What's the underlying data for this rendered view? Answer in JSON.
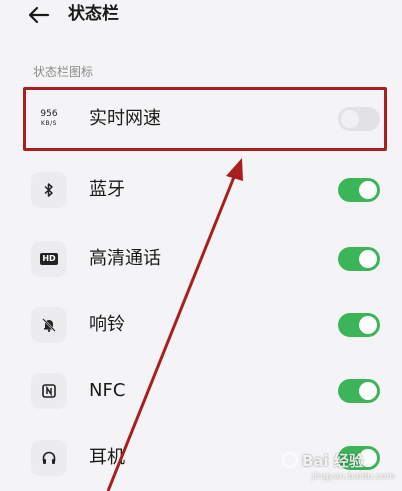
{
  "header": {
    "title": "状态栏",
    "back_icon": "back-arrow-icon"
  },
  "section": {
    "title": "状态栏图标"
  },
  "items": [
    {
      "label": "实时网速",
      "icon": "network-speed-icon",
      "icon_text_value": "956",
      "icon_text_unit": "KB/S",
      "enabled": false
    },
    {
      "label": "蓝牙",
      "icon": "bluetooth-icon",
      "enabled": true
    },
    {
      "label": "高清通话",
      "icon": "hd-icon",
      "icon_text_value": "HD",
      "enabled": true
    },
    {
      "label": "响铃",
      "icon": "bell-off-icon",
      "enabled": true
    },
    {
      "label": "NFC",
      "icon": "nfc-icon",
      "enabled": true
    },
    {
      "label": "耳机",
      "icon": "headphones-icon",
      "enabled": true
    }
  ],
  "annotation": {
    "color": "#a81f1f"
  },
  "watermark": {
    "text": "Bai 经验",
    "sub": "jingyan.baidu.com"
  },
  "colors": {
    "toggle_on": "#3cb45a",
    "toggle_off": "#e2e2e5",
    "background": "#f4f4f6"
  }
}
